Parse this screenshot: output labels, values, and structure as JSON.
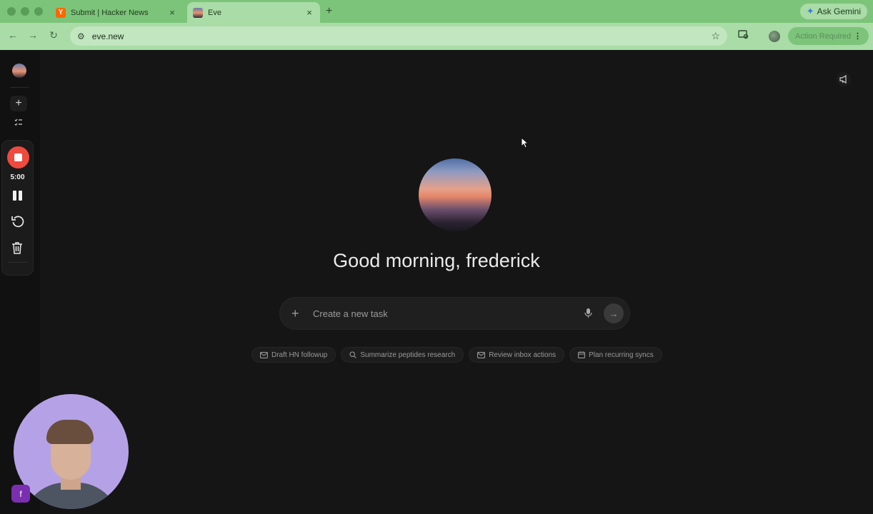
{
  "browser": {
    "tabs": [
      {
        "label": "Submit | Hacker News",
        "favicon": "Y"
      },
      {
        "label": "Eve"
      }
    ],
    "new_tab_icon": "+",
    "gemini_label": "Ask Gemini",
    "url": "eve.new",
    "action_pill_label": "Action Required"
  },
  "recorder": {
    "time": "5:00"
  },
  "main": {
    "greeting": "Good morning, frederick",
    "task_placeholder": "Create a new task",
    "suggestions": [
      {
        "label": "Draft HN followup",
        "icon": "mail-icon"
      },
      {
        "label": "Summarize peptides research",
        "icon": "search-icon"
      },
      {
        "label": "Review inbox actions",
        "icon": "mail-icon"
      },
      {
        "label": "Plan recurring syncs",
        "icon": "calendar-icon"
      }
    ]
  },
  "user": {
    "initial": "f"
  },
  "colors": {
    "chrome_green": "#7cc47a",
    "record_red": "#ef4a3f",
    "user_badge": "#7a2fb0"
  }
}
